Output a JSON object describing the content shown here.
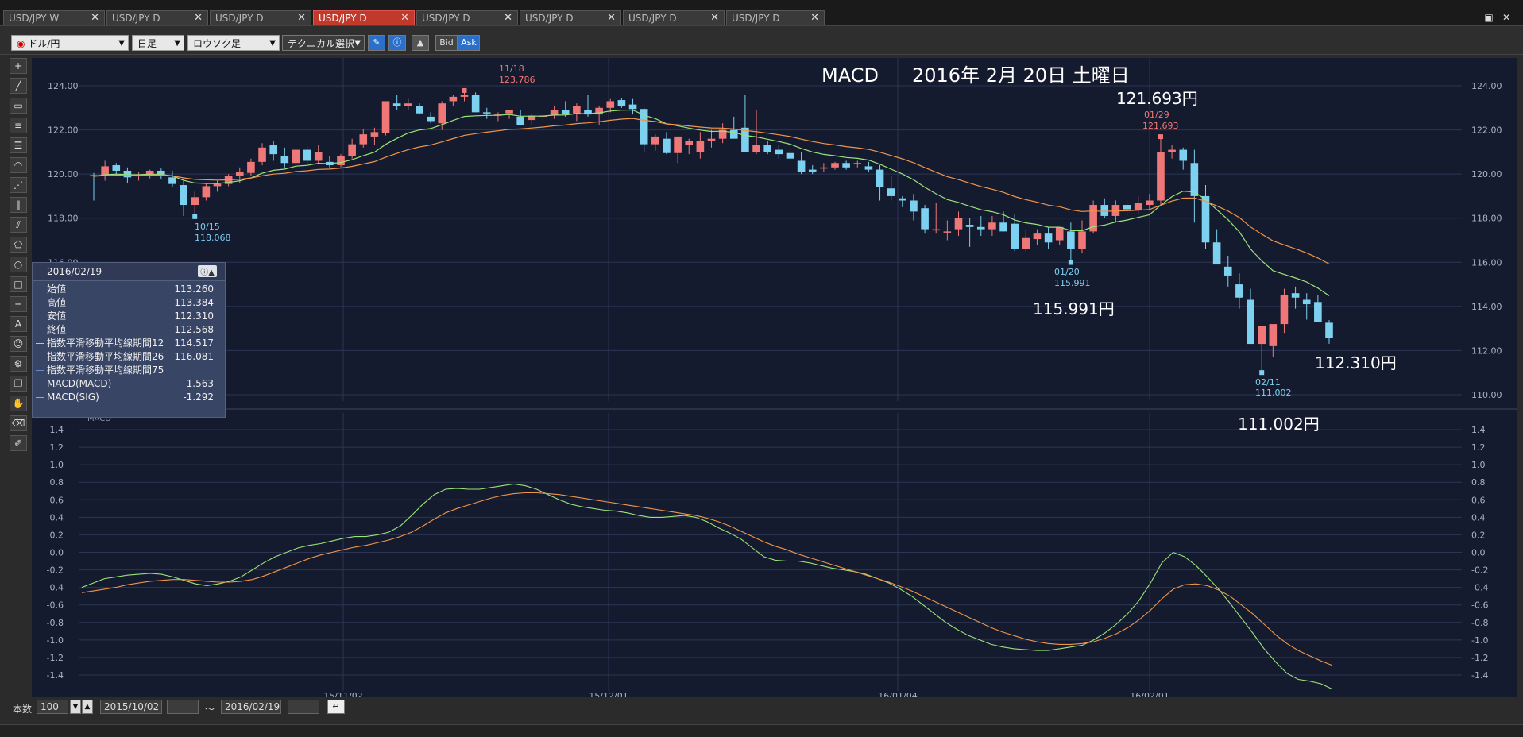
{
  "tabs": [
    {
      "label": "USD/JPY W",
      "active": false
    },
    {
      "label": "USD/JPY D",
      "active": false
    },
    {
      "label": "USD/JPY D",
      "active": false
    },
    {
      "label": "USD/JPY D",
      "active": true
    },
    {
      "label": "USD/JPY D",
      "active": false
    },
    {
      "label": "USD/JPY D",
      "active": false
    },
    {
      "label": "USD/JPY D",
      "active": false
    },
    {
      "label": "USD/JPY D",
      "active": false
    }
  ],
  "toolbar": {
    "currency": "ドル/円",
    "period": "日足",
    "chart_type": "ロウソク足",
    "technical": "テクニカル選択",
    "bid": "Bid",
    "ask": "Ask"
  },
  "overlay": {
    "title": "MACD",
    "date": "2016年 2月 20日 土曜日",
    "high_price": "121.693円",
    "low1_price": "115.991円",
    "close_price": "112.310円",
    "low2_price": "111.002円"
  },
  "annotations": {
    "a1": {
      "date": "11/18",
      "price": "123.786"
    },
    "a2": {
      "date": "10/15",
      "price": "118.068"
    },
    "a3": {
      "date": "01/29",
      "price": "121.693"
    },
    "a4": {
      "date": "01/20",
      "price": "115.991"
    },
    "a5": {
      "date": "02/11",
      "price": "111.002"
    }
  },
  "info": {
    "date": "2016/02/19",
    "rows": [
      {
        "label": "始値",
        "value": "113.260",
        "color": ""
      },
      {
        "label": "高値",
        "value": "113.384",
        "color": ""
      },
      {
        "label": "安値",
        "value": "112.310",
        "color": ""
      },
      {
        "label": "終値",
        "value": "112.568",
        "color": ""
      },
      {
        "label": "指数平滑移動平均線期間12",
        "value": "114.517",
        "color": "#9be27a"
      },
      {
        "label": "指数平滑移動平均線期間26",
        "value": "116.081",
        "color": "#f0954a"
      },
      {
        "label": "指数平滑移動平均線期間75",
        "value": "",
        "color": "#6f86c9"
      },
      {
        "label": "MACD(MACD)",
        "value": "-1.563",
        "color": "#9be27a"
      },
      {
        "label": "MACD(SIG)",
        "value": "-1.292",
        "color": "#f0954a"
      }
    ]
  },
  "macd_label": "MACD",
  "bottom": {
    "count_label": "本数",
    "count_value": "100",
    "from_date": "2015/10/02",
    "tilde": "～",
    "to_date": "2016/02/19"
  },
  "colors": {
    "bull": "#f07777",
    "bear": "#7cd0f0",
    "ema12": "#9be27a",
    "ema26": "#f0954a",
    "panel": "#151b2e",
    "grid": "#2c3654",
    "axis": "#aab3c6"
  },
  "chart_data": [
    {
      "type": "candlestick",
      "title": "",
      "x_ticks": [
        "15/11/02",
        "15/12/01",
        "16/01/04",
        "16/02/01"
      ],
      "ylim": [
        109.5,
        124.8
      ],
      "y_ticks": [
        110.0,
        112.0,
        114.0,
        116.0,
        118.0,
        120.0,
        122.0,
        124.0
      ],
      "grid": true,
      "candles": [
        [
          119.95,
          120.05,
          118.8,
          119.9
        ],
        [
          119.95,
          120.6,
          119.7,
          120.35
        ],
        [
          120.4,
          120.5,
          119.95,
          120.15
        ],
        [
          120.15,
          120.3,
          119.6,
          119.85
        ],
        [
          119.9,
          120.1,
          119.7,
          119.95
        ],
        [
          119.95,
          120.2,
          119.8,
          120.15
        ],
        [
          120.15,
          120.25,
          119.75,
          119.9
        ],
        [
          119.85,
          120.15,
          119.4,
          119.55
        ],
        [
          119.5,
          119.7,
          118.1,
          118.6
        ],
        [
          118.6,
          119.2,
          118.07,
          118.95
        ],
        [
          118.95,
          119.6,
          118.8,
          119.45
        ],
        [
          119.45,
          119.7,
          119.2,
          119.55
        ],
        [
          119.55,
          120.0,
          119.45,
          119.9
        ],
        [
          119.9,
          120.3,
          119.6,
          120.1
        ],
        [
          120.05,
          120.7,
          119.9,
          120.55
        ],
        [
          120.55,
          121.4,
          120.4,
          121.2
        ],
        [
          121.3,
          121.5,
          120.6,
          120.9
        ],
        [
          120.8,
          121.2,
          120.3,
          120.5
        ],
        [
          120.5,
          121.2,
          120.35,
          121.1
        ],
        [
          121.1,
          121.25,
          120.45,
          120.6
        ],
        [
          120.6,
          121.3,
          120.5,
          121.0
        ],
        [
          120.55,
          120.8,
          120.3,
          120.4
        ],
        [
          120.4,
          120.9,
          120.3,
          120.8
        ],
        [
          120.8,
          121.6,
          120.7,
          121.35
        ],
        [
          121.35,
          122.05,
          121.2,
          121.8
        ],
        [
          121.7,
          122.1,
          121.3,
          121.9
        ],
        [
          121.85,
          123.3,
          121.75,
          123.3
        ],
        [
          123.2,
          123.6,
          122.9,
          123.1
        ],
        [
          123.1,
          123.4,
          122.9,
          123.2
        ],
        [
          123.1,
          123.2,
          122.7,
          122.75
        ],
        [
          122.6,
          122.8,
          122.3,
          122.4
        ],
        [
          122.3,
          123.3,
          122.0,
          123.2
        ],
        [
          123.3,
          123.6,
          123.1,
          123.5
        ],
        [
          123.5,
          123.79,
          123.3,
          123.6
        ],
        [
          123.6,
          123.7,
          122.8,
          122.8
        ],
        [
          122.8,
          123.0,
          122.5,
          122.75
        ],
        [
          122.7,
          122.8,
          122.4,
          122.7
        ],
        [
          122.75,
          122.9,
          122.5,
          122.9
        ],
        [
          122.6,
          122.9,
          122.2,
          122.2
        ],
        [
          122.45,
          122.7,
          122.2,
          122.65
        ],
        [
          122.6,
          122.75,
          122.4,
          122.65
        ],
        [
          122.65,
          123.1,
          122.5,
          122.9
        ],
        [
          122.9,
          123.3,
          122.6,
          122.7
        ],
        [
          122.75,
          123.2,
          122.4,
          123.1
        ],
        [
          122.9,
          123.6,
          122.6,
          122.7
        ],
        [
          122.7,
          123.1,
          122.2,
          123.0
        ],
        [
          123.0,
          123.4,
          122.8,
          123.3
        ],
        [
          123.35,
          123.45,
          123.0,
          123.1
        ],
        [
          123.15,
          123.4,
          122.7,
          122.95
        ],
        [
          122.95,
          123.0,
          121.0,
          121.35
        ],
        [
          121.35,
          121.8,
          121.05,
          121.7
        ],
        [
          121.6,
          121.9,
          120.9,
          120.95
        ],
        [
          120.95,
          121.7,
          120.5,
          121.7
        ],
        [
          121.3,
          121.6,
          120.9,
          121.5
        ],
        [
          121.0,
          121.9,
          120.7,
          121.5
        ],
        [
          121.5,
          122.0,
          121.2,
          121.6
        ],
        [
          121.6,
          122.3,
          121.4,
          122.0
        ],
        [
          122.0,
          122.6,
          121.7,
          121.6
        ],
        [
          122.1,
          123.6,
          121.0,
          121.0
        ],
        [
          121.0,
          122.9,
          120.9,
          121.3
        ],
        [
          121.3,
          121.5,
          120.9,
          121.0
        ],
        [
          121.1,
          121.3,
          120.7,
          120.9
        ],
        [
          120.95,
          121.1,
          120.6,
          120.7
        ],
        [
          120.6,
          121.0,
          120.0,
          120.1
        ],
        [
          120.2,
          120.4,
          120.0,
          120.1
        ],
        [
          120.25,
          120.5,
          120.1,
          120.3
        ],
        [
          120.3,
          120.55,
          120.2,
          120.5
        ],
        [
          120.5,
          120.6,
          120.2,
          120.3
        ],
        [
          120.45,
          120.6,
          120.3,
          120.5
        ],
        [
          120.35,
          120.55,
          120.1,
          120.2
        ],
        [
          120.2,
          120.4,
          118.8,
          119.4
        ],
        [
          119.35,
          119.9,
          118.8,
          119.0
        ],
        [
          118.9,
          119.0,
          118.5,
          118.8
        ],
        [
          118.8,
          119.1,
          117.9,
          118.3
        ],
        [
          118.45,
          118.6,
          117.3,
          117.5
        ],
        [
          117.5,
          118.7,
          117.3,
          117.5
        ],
        [
          117.4,
          117.9,
          117.0,
          117.4
        ],
        [
          117.5,
          118.3,
          117.2,
          118.0
        ],
        [
          117.7,
          118.0,
          116.7,
          117.6
        ],
        [
          117.6,
          118.1,
          117.2,
          117.5
        ],
        [
          117.5,
          118.1,
          117.2,
          117.8
        ],
        [
          117.8,
          118.3,
          117.4,
          117.4
        ],
        [
          117.75,
          118.2,
          116.5,
          116.6
        ],
        [
          116.6,
          117.5,
          116.5,
          117.1
        ],
        [
          117.05,
          117.5,
          116.8,
          117.3
        ],
        [
          117.3,
          117.6,
          116.6,
          116.9
        ],
        [
          117.0,
          117.6,
          116.8,
          117.6
        ],
        [
          117.4,
          117.8,
          115.99,
          116.6
        ],
        [
          116.6,
          117.9,
          116.4,
          117.4
        ],
        [
          117.4,
          118.8,
          117.3,
          118.6
        ],
        [
          118.6,
          118.9,
          118.0,
          118.1
        ],
        [
          118.1,
          118.8,
          117.8,
          118.6
        ],
        [
          118.6,
          118.8,
          118.1,
          118.4
        ],
        [
          118.35,
          119.0,
          118.2,
          118.7
        ],
        [
          118.6,
          119.1,
          118.4,
          118.8
        ],
        [
          118.8,
          121.69,
          118.6,
          121.0
        ],
        [
          121.0,
          121.3,
          120.7,
          121.1
        ],
        [
          121.1,
          121.2,
          120.2,
          120.6
        ],
        [
          120.5,
          121.1,
          117.8,
          119.0
        ],
        [
          119.0,
          119.5,
          116.6,
          116.9
        ],
        [
          116.9,
          117.5,
          116.0,
          115.9
        ],
        [
          115.8,
          116.3,
          114.9,
          115.4
        ],
        [
          115.0,
          115.5,
          113.9,
          114.4
        ],
        [
          114.3,
          114.8,
          112.5,
          112.3
        ],
        [
          112.3,
          113.0,
          111.0,
          113.1
        ],
        [
          112.2,
          113.1,
          111.7,
          113.2
        ],
        [
          113.2,
          114.8,
          112.8,
          114.5
        ],
        [
          114.6,
          114.9,
          113.9,
          114.4
        ],
        [
          114.3,
          114.6,
          113.4,
          114.1
        ],
        [
          114.2,
          114.5,
          113.4,
          113.3
        ],
        [
          113.26,
          113.38,
          112.31,
          112.57
        ]
      ],
      "ema12_label": "指数平滑移動平均線期間12",
      "ema26_label": "指数平滑移動平均線期間26"
    },
    {
      "type": "line",
      "title": "MACD",
      "x_ticks": [
        "15/11/02",
        "15/12/01",
        "16/01/04",
        "16/02/01"
      ],
      "ylim": [
        -1.5,
        1.5
      ],
      "y_ticks": [
        1.4,
        1.2,
        1.0,
        0.8,
        0.6,
        0.4,
        0.2,
        0.0,
        -0.2,
        -0.4,
        -0.6,
        -0.8,
        -1.0,
        -1.2,
        -1.4
      ],
      "grid": true,
      "series": [
        {
          "name": "MACD(MACD)",
          "values": [
            -0.4,
            -0.35,
            -0.3,
            -0.28,
            -0.26,
            -0.25,
            -0.24,
            -0.25,
            -0.28,
            -0.32,
            -0.36,
            -0.38,
            -0.36,
            -0.33,
            -0.28,
            -0.2,
            -0.12,
            -0.05,
            0.0,
            0.05,
            0.08,
            0.1,
            0.13,
            0.16,
            0.18,
            0.18,
            0.2,
            0.23,
            0.3,
            0.42,
            0.55,
            0.66,
            0.72,
            0.73,
            0.72,
            0.72,
            0.74,
            0.76,
            0.78,
            0.76,
            0.72,
            0.66,
            0.6,
            0.55,
            0.52,
            0.5,
            0.48,
            0.47,
            0.45,
            0.42,
            0.4,
            0.4,
            0.41,
            0.42,
            0.4,
            0.35,
            0.28,
            0.22,
            0.15,
            0.05,
            -0.05,
            -0.09,
            -0.1,
            -0.1,
            -0.12,
            -0.15,
            -0.18,
            -0.2,
            -0.22,
            -0.25,
            -0.3,
            -0.35,
            -0.42,
            -0.5,
            -0.6,
            -0.7,
            -0.8,
            -0.88,
            -0.95,
            -1.0,
            -1.05,
            -1.08,
            -1.1,
            -1.11,
            -1.12,
            -1.12,
            -1.1,
            -1.08,
            -1.06,
            -1.0,
            -0.92,
            -0.82,
            -0.7,
            -0.55,
            -0.35,
            -0.12,
            0.0,
            -0.05,
            -0.15,
            -0.28,
            -0.42,
            -0.58,
            -0.75,
            -0.92,
            -1.1,
            -1.25,
            -1.38,
            -1.45,
            -1.47,
            -1.5,
            -1.56
          ]
        },
        {
          "name": "MACD(SIG)",
          "values": [
            -0.46,
            -0.44,
            -0.42,
            -0.4,
            -0.37,
            -0.35,
            -0.33,
            -0.32,
            -0.31,
            -0.31,
            -0.32,
            -0.33,
            -0.34,
            -0.34,
            -0.33,
            -0.31,
            -0.27,
            -0.22,
            -0.17,
            -0.12,
            -0.07,
            -0.03,
            0.0,
            0.03,
            0.06,
            0.08,
            0.11,
            0.14,
            0.18,
            0.23,
            0.3,
            0.38,
            0.45,
            0.5,
            0.54,
            0.58,
            0.62,
            0.65,
            0.67,
            0.68,
            0.68,
            0.67,
            0.66,
            0.64,
            0.62,
            0.6,
            0.58,
            0.56,
            0.54,
            0.52,
            0.5,
            0.48,
            0.46,
            0.44,
            0.42,
            0.39,
            0.35,
            0.3,
            0.24,
            0.18,
            0.12,
            0.07,
            0.03,
            -0.02,
            -0.06,
            -0.1,
            -0.14,
            -0.18,
            -0.22,
            -0.26,
            -0.3,
            -0.34,
            -0.39,
            -0.44,
            -0.5,
            -0.56,
            -0.62,
            -0.68,
            -0.74,
            -0.8,
            -0.86,
            -0.91,
            -0.95,
            -0.99,
            -1.02,
            -1.04,
            -1.05,
            -1.05,
            -1.04,
            -1.02,
            -0.98,
            -0.93,
            -0.86,
            -0.77,
            -0.66,
            -0.53,
            -0.42,
            -0.37,
            -0.36,
            -0.38,
            -0.43,
            -0.5,
            -0.6,
            -0.7,
            -0.82,
            -0.94,
            -1.04,
            -1.12,
            -1.18,
            -1.24,
            -1.29
          ]
        }
      ]
    }
  ]
}
